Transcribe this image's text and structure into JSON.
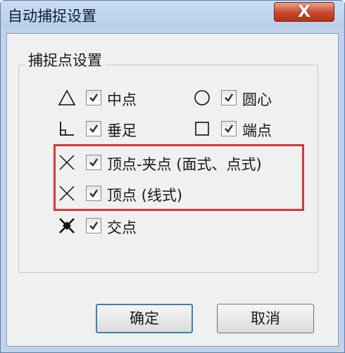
{
  "window": {
    "title": "自动捕捉设置",
    "close_label": "X"
  },
  "group": {
    "title": "捕捉点设置"
  },
  "options": {
    "midpoint": {
      "label": "中点",
      "checked": true,
      "icon": "triangle-icon"
    },
    "center": {
      "label": "圆心",
      "checked": true,
      "icon": "circle-icon"
    },
    "perpendicular": {
      "label": "垂足",
      "checked": true,
      "icon": "perpendicular-icon"
    },
    "endpoint": {
      "label": "端点",
      "checked": true,
      "icon": "square-icon"
    },
    "vertex_grip": {
      "label": "顶点-夹点 (面式、点式)",
      "checked": true,
      "icon": "cross-icon"
    },
    "vertex_line": {
      "label": "顶点 (线式)",
      "checked": true,
      "icon": "cross-icon"
    },
    "intersection": {
      "label": "交点",
      "checked": true,
      "icon": "intersection-icon"
    }
  },
  "buttons": {
    "ok": "确定",
    "cancel": "取消"
  },
  "colors": {
    "highlight": "#d6393c",
    "close_button": "#c8462c",
    "default_button_border": "#3c7fb1"
  }
}
